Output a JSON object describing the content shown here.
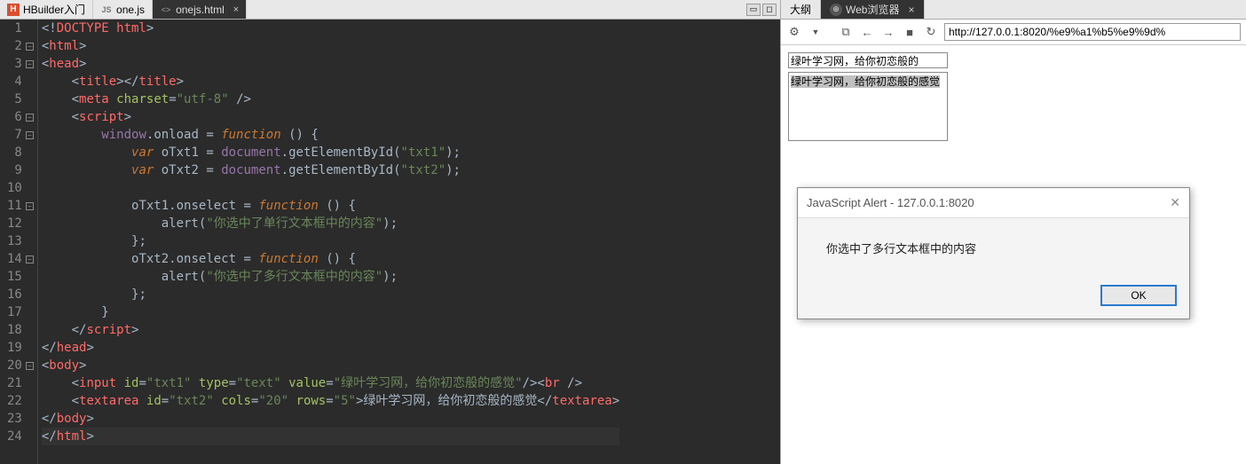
{
  "left": {
    "tabs": [
      {
        "label": "HBuilder入门",
        "icon": "H",
        "active": false
      },
      {
        "label": "one.js",
        "icon": "JS",
        "active": false
      },
      {
        "label": "onejs.html",
        "icon": "<>",
        "active": true
      }
    ]
  },
  "code": {
    "lines": [
      {
        "n": 1,
        "fold": false,
        "html": "<span class='punct'>&lt;!</span><span class='doctype'>DOCTYPE html</span><span class='punct'>&gt;</span>"
      },
      {
        "n": 2,
        "fold": true,
        "html": "<span class='punct'>&lt;</span><span class='tagname'>html</span><span class='punct'>&gt;</span>"
      },
      {
        "n": 3,
        "fold": true,
        "html": "<span class='punct'>&lt;</span><span class='tagname'>head</span><span class='punct'>&gt;</span>"
      },
      {
        "n": 4,
        "fold": false,
        "html": "    <span class='punct'>&lt;</span><span class='tagname'>title</span><span class='punct'>&gt;&lt;/</span><span class='tagname'>title</span><span class='punct'>&gt;</span>"
      },
      {
        "n": 5,
        "fold": false,
        "html": "    <span class='punct'>&lt;</span><span class='tagname'>meta</span> <span class='attrname'>charset</span><span class='punct'>=</span><span class='str'>\"utf-8\"</span> <span class='punct'>/&gt;</span>"
      },
      {
        "n": 6,
        "fold": true,
        "html": "    <span class='punct'>&lt;</span><span class='tagname'>script</span><span class='punct'>&gt;</span>"
      },
      {
        "n": 7,
        "fold": true,
        "html": "        <span class='ident'>window</span><span class='punct'>.</span><span class='jsident'>onload</span> <span class='punct'>=</span> <span class='jskw'>function</span> <span class='punct'>() {</span>"
      },
      {
        "n": 8,
        "fold": false,
        "html": "            <span class='jskw'>var</span> <span class='jsident'>oTxt1</span> <span class='punct'>=</span> <span class='ident'>document</span><span class='punct'>.</span><span class='jsident'>getElementById</span><span class='punct'>(</span><span class='str'>\"txt1\"</span><span class='punct'>);</span>"
      },
      {
        "n": 9,
        "fold": false,
        "html": "            <span class='jskw'>var</span> <span class='jsident'>oTxt2</span> <span class='punct'>=</span> <span class='ident'>document</span><span class='punct'>.</span><span class='jsident'>getElementById</span><span class='punct'>(</span><span class='str'>\"txt2\"</span><span class='punct'>);</span>"
      },
      {
        "n": 10,
        "fold": false,
        "html": ""
      },
      {
        "n": 11,
        "fold": true,
        "html": "            <span class='jsident'>oTxt1</span><span class='punct'>.</span><span class='jsident'>onselect</span> <span class='punct'>=</span> <span class='jskw'>function</span> <span class='punct'>() {</span>"
      },
      {
        "n": 12,
        "fold": false,
        "html": "                <span class='jsident'>alert</span><span class='punct'>(</span><span class='str'>\"你选中了单行文本框中的内容\"</span><span class='punct'>);</span>"
      },
      {
        "n": 13,
        "fold": false,
        "html": "            <span class='punct'>};</span>"
      },
      {
        "n": 14,
        "fold": true,
        "html": "            <span class='jsident'>oTxt2</span><span class='punct'>.</span><span class='jsident'>onselect</span> <span class='punct'>=</span> <span class='jskw'>function</span> <span class='punct'>() {</span>"
      },
      {
        "n": 15,
        "fold": false,
        "html": "                <span class='jsident'>alert</span><span class='punct'>(</span><span class='str'>\"你选中了多行文本框中的内容\"</span><span class='punct'>);</span>"
      },
      {
        "n": 16,
        "fold": false,
        "html": "            <span class='punct'>};</span>"
      },
      {
        "n": 17,
        "fold": false,
        "html": "        <span class='punct'>}</span>"
      },
      {
        "n": 18,
        "fold": false,
        "html": "    <span class='punct'>&lt;/</span><span class='tagname'>script</span><span class='punct'>&gt;</span>"
      },
      {
        "n": 19,
        "fold": false,
        "html": "<span class='punct'>&lt;/</span><span class='tagname'>head</span><span class='punct'>&gt;</span>"
      },
      {
        "n": 20,
        "fold": true,
        "html": "<span class='punct'>&lt;</span><span class='tagname'>body</span><span class='punct'>&gt;</span>"
      },
      {
        "n": 21,
        "fold": false,
        "html": "    <span class='punct'>&lt;</span><span class='tagname'>input</span> <span class='attrname'>id</span><span class='punct'>=</span><span class='str'>\"txt1\"</span> <span class='attrname'>type</span><span class='punct'>=</span><span class='str'>\"text\"</span> <span class='attrname'>value</span><span class='punct'>=</span><span class='str'>\"绿叶学习网，给你初恋般的感觉\"</span><span class='punct'>/&gt;&lt;</span><span class='tagname'>br</span> <span class='punct'>/&gt;</span>"
      },
      {
        "n": 22,
        "fold": false,
        "html": "    <span class='punct'>&lt;</span><span class='tagname'>textarea</span> <span class='attrname'>id</span><span class='punct'>=</span><span class='str'>\"txt2\"</span> <span class='attrname'>cols</span><span class='punct'>=</span><span class='str'>\"20\"</span> <span class='attrname'>rows</span><span class='punct'>=</span><span class='str'>\"5\"</span><span class='punct'>&gt;</span>绿叶学习网，给你初恋般的感觉<span class='punct'>&lt;/</span><span class='tagname'>textarea</span><span class='punct'>&gt;</span>"
      },
      {
        "n": 23,
        "fold": false,
        "html": "<span class='punct'>&lt;/</span><span class='tagname'>body</span><span class='punct'>&gt;</span>"
      },
      {
        "n": 24,
        "fold": false,
        "current": true,
        "html": "<span class='punct'>&lt;/</span><span class='tagname'>html</span><span class='punct'>&gt;</span>"
      }
    ]
  },
  "right": {
    "tabs": [
      {
        "label": "大纲",
        "active": false
      },
      {
        "label": "Web浏览器",
        "active": true,
        "closable": true,
        "icon": "globe"
      }
    ],
    "url": "http://127.0.0.1:8020/%e9%a1%b5%e9%9d%",
    "input_value": "绿叶学习网，给你初恋般的",
    "textarea_value": "绿叶学习网，给你初恋般的感觉"
  },
  "dialog": {
    "title": "JavaScript Alert - 127.0.0.1:8020",
    "message": "你选中了多行文本框中的内容",
    "ok": "OK"
  }
}
